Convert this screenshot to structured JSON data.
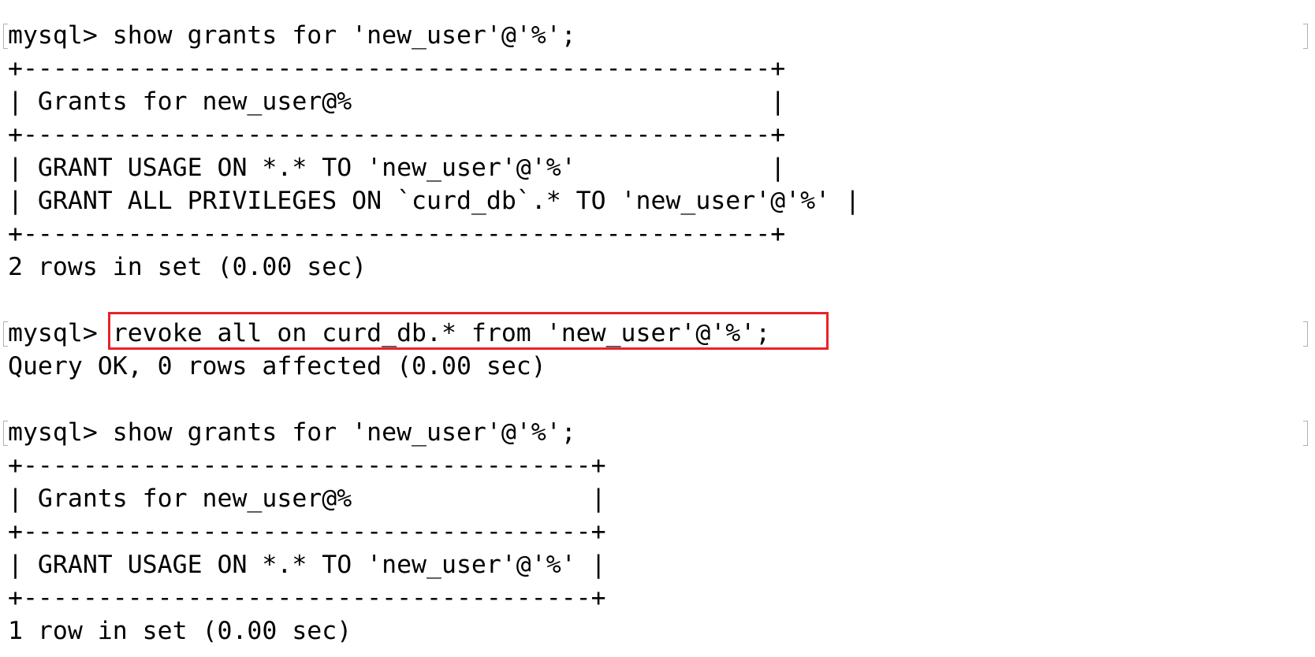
{
  "terminal": {
    "lines": [
      "mysql> show grants for 'new_user'@'%';",
      "+--------------------------------------------------+",
      "| Grants for new_user@%                            |",
      "+--------------------------------------------------+",
      "| GRANT USAGE ON *.* TO 'new_user'@'%'             |",
      "| GRANT ALL PRIVILEGES ON `curd_db`.* TO 'new_user'@'%' |",
      "+--------------------------------------------------+",
      "2 rows in set (0.00 sec)",
      "",
      "mysql> revoke all on curd_db.* from 'new_user'@'%';",
      "Query OK, 0 rows affected (0.00 sec)",
      "",
      "mysql> show grants for 'new_user'@'%';",
      "+--------------------------------------+",
      "| Grants for new_user@%                |",
      "+--------------------------------------+",
      "| GRANT USAGE ON *.* TO 'new_user'@'%' |",
      "+--------------------------------------+",
      "1 row in set (0.00 sec)"
    ]
  },
  "colors": {
    "highlight": "#e8232a",
    "text": "#000000",
    "background": "#ffffff"
  }
}
